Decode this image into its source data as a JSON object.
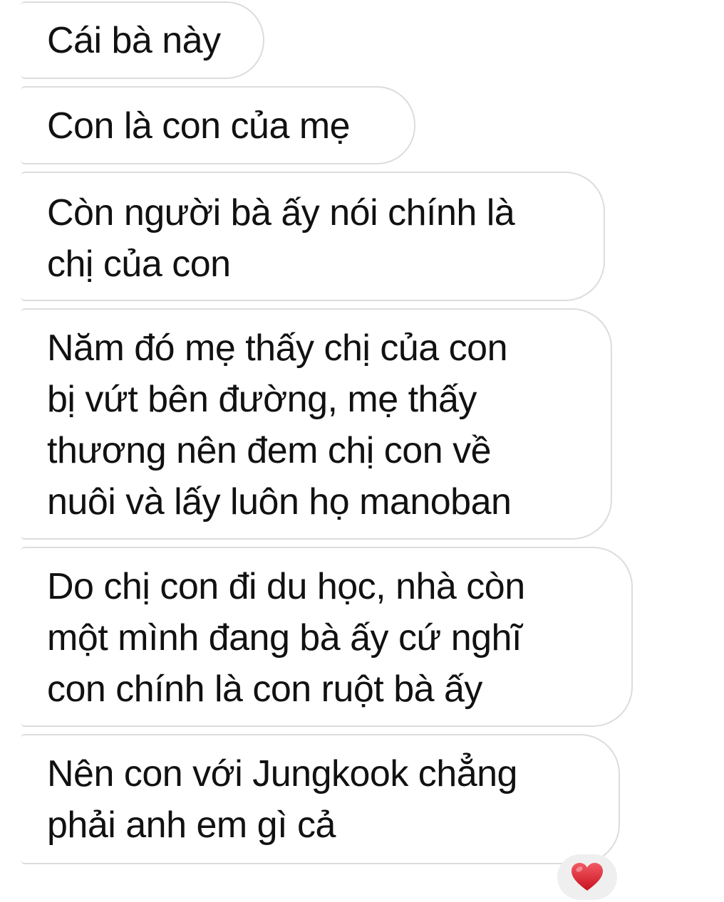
{
  "conversation": {
    "messages": [
      {
        "text": "Cái bà này"
      },
      {
        "text": "Con là con của mẹ"
      },
      {
        "text": "Còn người bà ấy nói chính là\nchị của con"
      },
      {
        "text": "Năm đó mẹ thấy chị của con\nbị vứt bên đường, mẹ thấy\nthương nên đem chị con về\nnuôi và lấy luôn họ manoban"
      },
      {
        "text": "Do chị con đi du học, nhà còn\nmột mình đang bà ấy cứ nghĩ\ncon chính là con ruột bà ấy"
      },
      {
        "text": "Nên con với Jungkook chẳng\nphải anh em gì cả"
      }
    ],
    "reaction": {
      "icon": "heart-icon",
      "color": "#e0303e"
    }
  }
}
